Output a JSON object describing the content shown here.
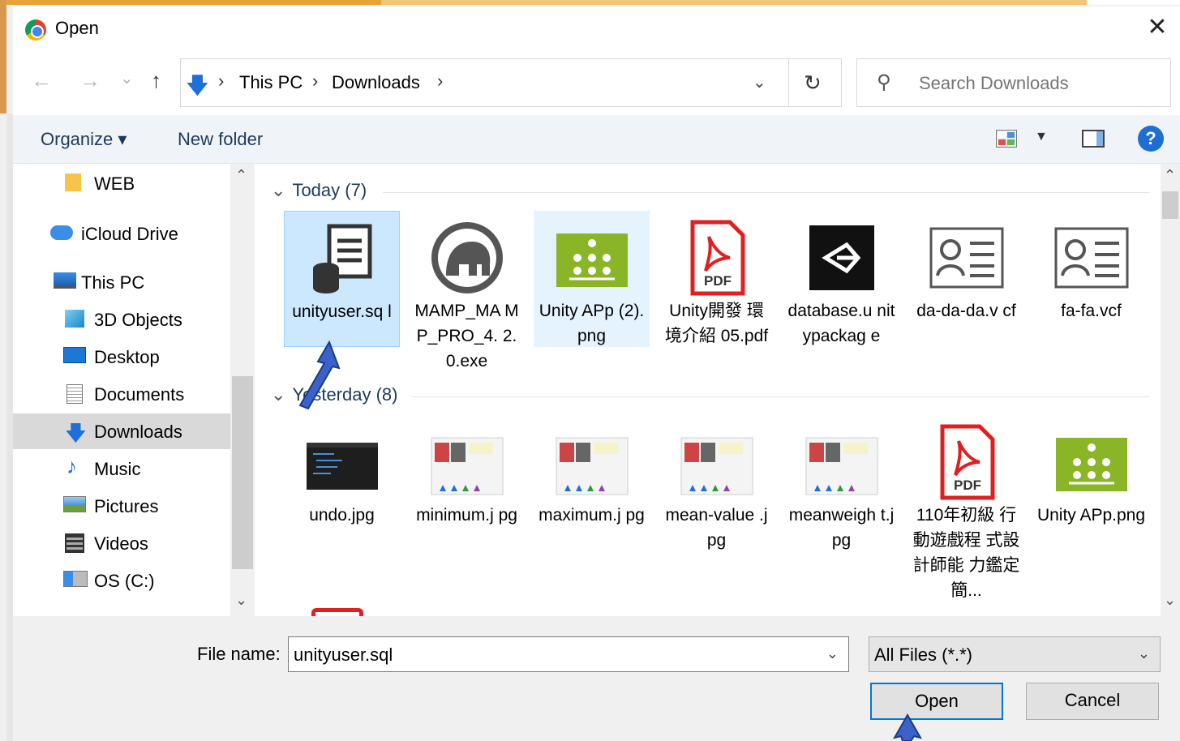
{
  "window": {
    "title": "Open",
    "close_glyph": "✕"
  },
  "nav": {
    "back_glyph": "←",
    "forward_glyph": "→",
    "recent_glyph": "⌄",
    "up_glyph": "↑",
    "breadcrumb": [
      "This PC",
      "Downloads"
    ],
    "separator": "›",
    "dropdown_glyph": "⌄",
    "refresh_glyph": "↻",
    "search_placeholder": "Search Downloads"
  },
  "toolbar": {
    "organize": "Organize ▾",
    "new_folder": "New folder",
    "view_dropdown": "▼",
    "help": "?"
  },
  "sidebar": {
    "items": [
      {
        "label": "WEB",
        "icon": "folder-icon"
      },
      {
        "label": "iCloud Drive",
        "icon": "cloud-icon"
      },
      {
        "label": "This PC",
        "icon": "computer-icon"
      },
      {
        "label": "3D Objects",
        "icon": "cube-icon"
      },
      {
        "label": "Desktop",
        "icon": "desktop-icon"
      },
      {
        "label": "Documents",
        "icon": "documents-icon"
      },
      {
        "label": "Downloads",
        "icon": "download-icon"
      },
      {
        "label": "Music",
        "icon": "music-icon"
      },
      {
        "label": "Pictures",
        "icon": "pictures-icon"
      },
      {
        "label": "Videos",
        "icon": "videos-icon"
      },
      {
        "label": "OS (C:)",
        "icon": "drive-icon"
      }
    ],
    "selected": "Downloads",
    "scroll_up": "⌃",
    "scroll_down": "⌄"
  },
  "groups": [
    {
      "header": "Today (7)",
      "files": [
        {
          "name": "unityuser.sq l",
          "icon": "sql-file-icon"
        },
        {
          "name": "MAMP_MA MP_PRO_4. 2.0.exe",
          "icon": "mamp-icon"
        },
        {
          "name": "Unity APp (2).png",
          "icon": "image-thumbnail"
        },
        {
          "name": "Unity開發 環境介紹 05.pdf",
          "icon": "pdf-icon",
          "badge": "PDF"
        },
        {
          "name": "database.u nitypackag e",
          "icon": "unity-icon"
        },
        {
          "name": "da-da-da.v cf",
          "icon": "contact-card-icon"
        },
        {
          "name": "fa-fa.vcf",
          "icon": "contact-card-icon"
        }
      ]
    },
    {
      "header": "Yesterday (8)",
      "files": [
        {
          "name": "undo.jpg",
          "icon": "image-thumbnail"
        },
        {
          "name": "minimum.j pg",
          "icon": "image-thumbnail"
        },
        {
          "name": "maximum.j pg",
          "icon": "image-thumbnail"
        },
        {
          "name": "mean-value .jpg",
          "icon": "image-thumbnail"
        },
        {
          "name": "meanweigh t.jpg",
          "icon": "image-thumbnail"
        },
        {
          "name": "110年初級 行動遊戲程 式設計師能 力鑑定簡...",
          "icon": "pdf-icon",
          "badge": "PDF"
        },
        {
          "name": "Unity APp.png",
          "icon": "image-thumbnail"
        }
      ]
    }
  ],
  "footer": {
    "file_name_label": "File name:",
    "file_name_value": "unityuser.sql",
    "filter_value": "All Files (*.*)",
    "dropdown_glyph": "⌄",
    "open": "Open",
    "cancel": "Cancel"
  },
  "colors": {
    "accent": "#0078d7",
    "selection": "#cce8ff",
    "link": "#1e395b",
    "unity_green": "#8ab526"
  }
}
